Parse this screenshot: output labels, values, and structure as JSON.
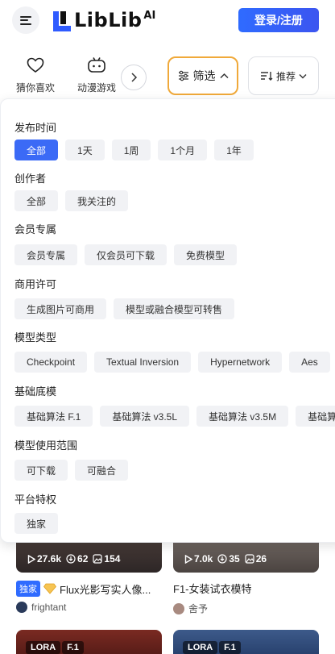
{
  "header": {
    "logo_text": "LibLib",
    "logo_sup": "AI",
    "login_label": "登录/注册"
  },
  "categories": [
    {
      "icon": "heart-icon",
      "label": "猜你喜欢"
    },
    {
      "icon": "gamepad-icon",
      "label": "动漫游戏"
    }
  ],
  "filter_label": "筛选",
  "sort_label": "推荐",
  "filter_panel": {
    "sections": [
      {
        "title": "发布时间",
        "options": [
          "全部",
          "1天",
          "1周",
          "1个月",
          "1年"
        ],
        "selected": 0
      },
      {
        "title": "创作者",
        "options": [
          "全部",
          "我关注的"
        ]
      },
      {
        "title": "会员专属",
        "options": [
          "会员专属",
          "仅会员可下载",
          "免费模型"
        ]
      },
      {
        "title": "商用许可",
        "options": [
          "生成图片可商用",
          "模型或融合模型可转售"
        ]
      },
      {
        "title": "模型类型",
        "options": [
          "Checkpoint",
          "Textual Inversion",
          "Hypernetwork",
          "Aes"
        ]
      },
      {
        "title": "基础底模",
        "options": [
          "基础算法 F.1",
          "基础算法 v3.5L",
          "基础算法 v3.5M",
          "基础算"
        ]
      },
      {
        "title": "模型使用范围",
        "options": [
          "可下载",
          "可融合"
        ]
      },
      {
        "title": "平台特权",
        "options": [
          "独家"
        ]
      }
    ]
  },
  "cards": [
    {
      "plays": "27.6k",
      "downloads": "62",
      "images": "154",
      "badge": "独家",
      "title": "Flux光影写实人像...",
      "author": "frightant"
    },
    {
      "plays": "7.0k",
      "downloads": "35",
      "images": "26",
      "title": "F1-女装试衣模特",
      "author": "舍予"
    }
  ],
  "bottom_cards": [
    {
      "tag1": "LORA",
      "tag2": "F.1"
    },
    {
      "tag1": "LORA",
      "tag2": "F.1"
    }
  ],
  "colors": {
    "accent": "#3b6af6",
    "filter_border": "#f0a93a",
    "chip_bg": "#f1f2f5"
  }
}
